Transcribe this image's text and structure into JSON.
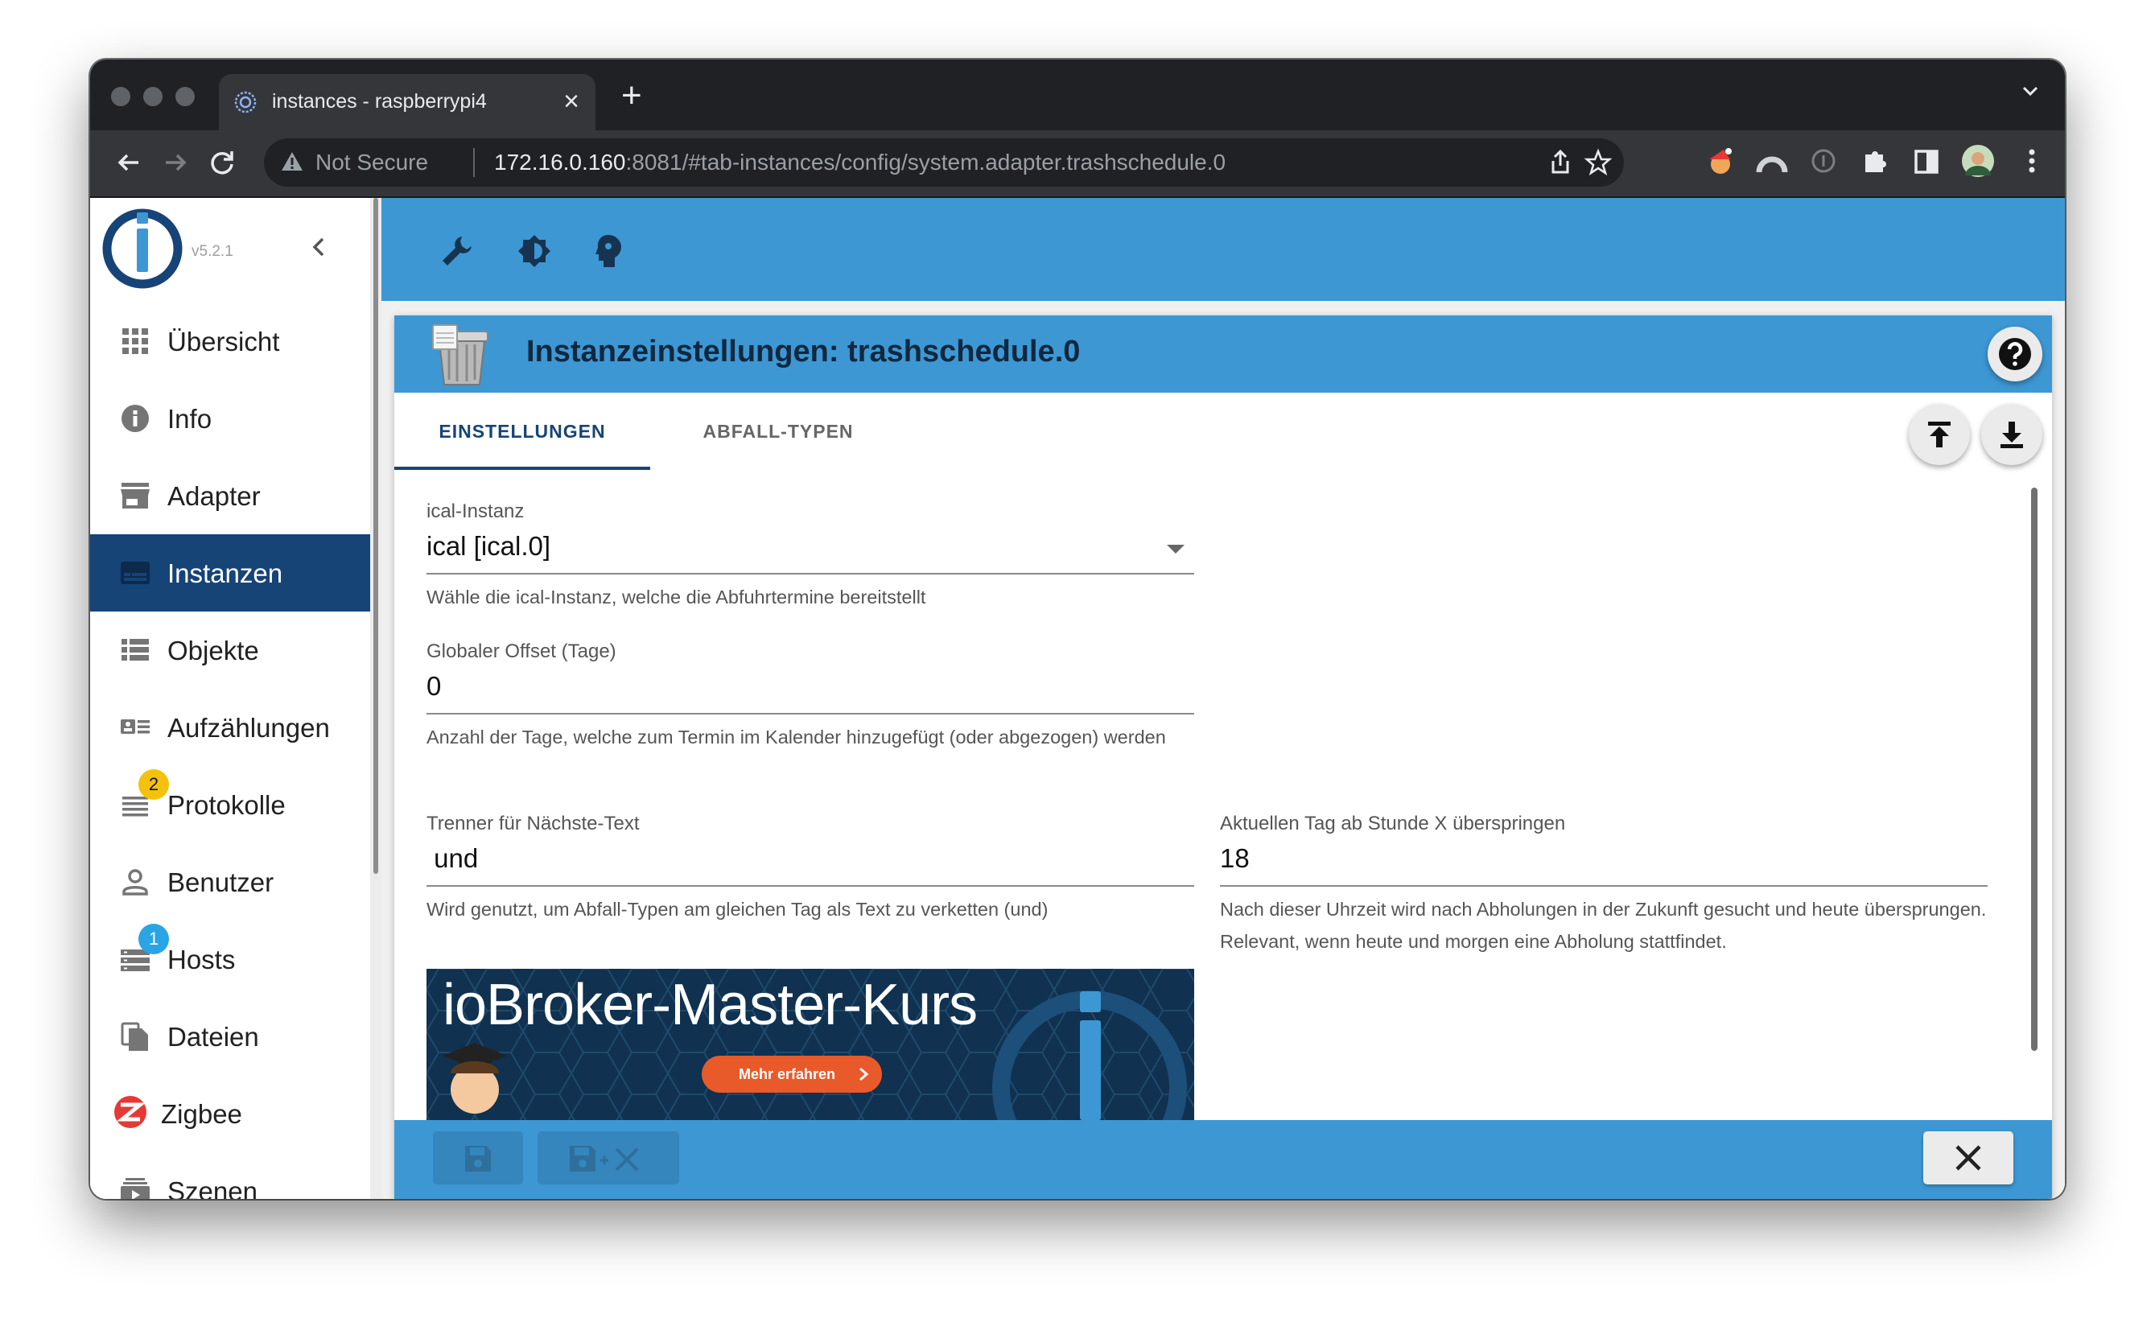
{
  "browser": {
    "tab_title": "instances - raspberrypi4",
    "security_label": "Not Secure",
    "url_host": "172.16.0.160",
    "url_rest": ":8081/#tab-instances/config/system.adapter.trashschedule.0"
  },
  "sidebar": {
    "version": "v5.2.1",
    "items": [
      {
        "label": "Übersicht",
        "icon": "grid-icon"
      },
      {
        "label": "Info",
        "icon": "info-icon"
      },
      {
        "label": "Adapter",
        "icon": "store-icon"
      },
      {
        "label": "Instanzen",
        "icon": "instances-icon",
        "active": true
      },
      {
        "label": "Objekte",
        "icon": "list-icon"
      },
      {
        "label": "Aufzählungen",
        "icon": "enum-icon"
      },
      {
        "label": "Protokolle",
        "icon": "log-icon",
        "badge": "2",
        "badge_color": "#f4c20d"
      },
      {
        "label": "Benutzer",
        "icon": "user-icon"
      },
      {
        "label": "Hosts",
        "icon": "hosts-icon",
        "badge": "1",
        "badge_color": "#2aa4e4"
      },
      {
        "label": "Dateien",
        "icon": "files-icon"
      },
      {
        "label": "Zigbee",
        "icon": "zigbee-icon"
      },
      {
        "label": "Szenen",
        "icon": "scenes-icon"
      }
    ]
  },
  "dialog": {
    "title": "Instanzeinstellungen: trashschedule.0",
    "tabs": [
      "EINSTELLUNGEN",
      "ABFALL-TYPEN"
    ],
    "fields": {
      "ical": {
        "label": "ical-Instanz",
        "value": "ical [ical.0]",
        "help": "Wähle die ical-Instanz, welche die Abfuhrtermine bereitstellt"
      },
      "offset": {
        "label": "Globaler Offset (Tage)",
        "value": "0",
        "help": "Anzahl der Tage, welche zum Termin im Kalender hinzugefügt (oder abgezogen) werden"
      },
      "separator": {
        "label": "Trenner für Nächste-Text",
        "value": " und",
        "help": "Wird genutzt, um Abfall-Typen am gleichen Tag als Text zu verketten (und)"
      },
      "skip_hour": {
        "label": "Aktuellen Tag ab Stunde X überspringen",
        "value": "18",
        "help": "Nach dieser Uhrzeit wird nach Abholungen in der Zukunft gesucht und heute übersprungen. Relevant, wenn heute und morgen eine Abholung stattfindet."
      }
    },
    "banner": {
      "title": "ioBroker-Master-Kurs",
      "button": "Mehr erfahren"
    }
  },
  "colors": {
    "accent": "#3d97d3",
    "sidebar_active": "#164477",
    "chrome_dark": "#202124"
  }
}
